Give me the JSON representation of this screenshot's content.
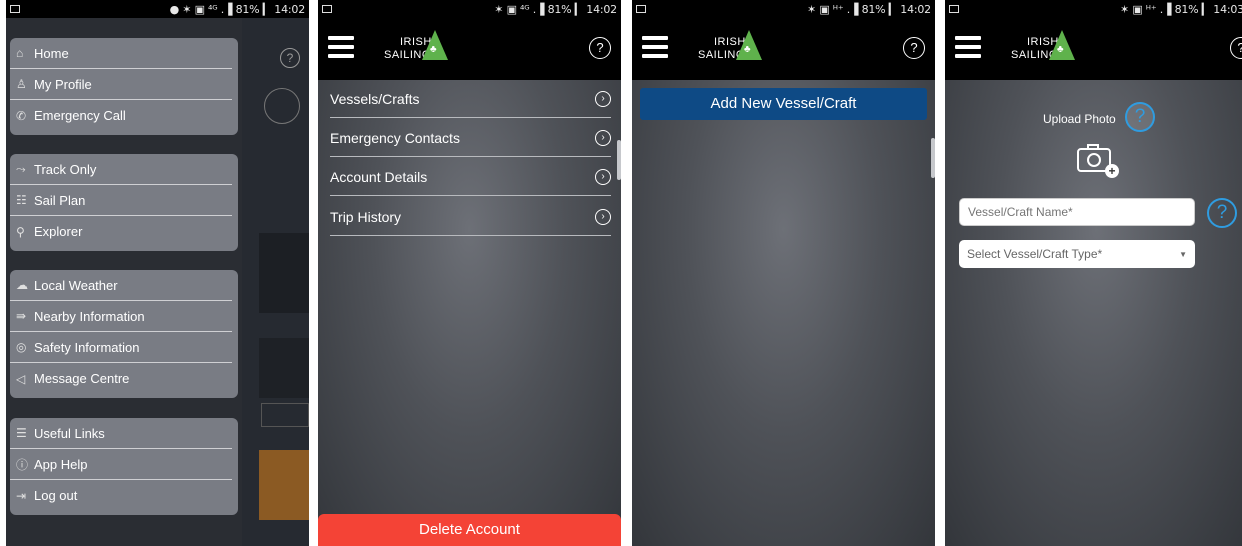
{
  "status_bar": {
    "p1": "● ✶ ▣ ⁴ᴳ .▐ 81% ▎ 14:02",
    "p2": "✶ ▣ ⁴ᴳ .▐ 81% ▎ 14:02",
    "p3": "✶ ▣ ᴴ⁺ .▐ 81% ▎ 14:02",
    "p4": "✶ ▣ ᴴ⁺ .▐ 81% ▎ 14:03"
  },
  "logo": {
    "line1": "IRISH",
    "line2": "SAILING"
  },
  "help_glyph": "?",
  "drawer": {
    "group1": [
      {
        "label": "Home",
        "icon": "home-icon"
      },
      {
        "label": "My Profile",
        "icon": "profile-icon"
      },
      {
        "label": "Emergency Call",
        "icon": "phone-icon"
      }
    ],
    "group2": [
      {
        "label": "Track Only",
        "icon": "track-icon"
      },
      {
        "label": "Sail Plan",
        "icon": "sail-plan-icon"
      },
      {
        "label": "Explorer",
        "icon": "explorer-icon"
      }
    ],
    "group3": [
      {
        "label": "Local Weather",
        "icon": "weather-icon"
      },
      {
        "label": "Nearby Information",
        "icon": "nearby-icon"
      },
      {
        "label": "Safety Information",
        "icon": "lifebuoy-icon"
      },
      {
        "label": "Message Centre",
        "icon": "megaphone-icon"
      }
    ],
    "group4": [
      {
        "label": "Useful Links",
        "icon": "links-icon"
      },
      {
        "label": "App Help",
        "icon": "info-icon"
      },
      {
        "label": "Log out",
        "icon": "logout-icon"
      }
    ]
  },
  "account_menu": {
    "items": [
      "Vessels/Crafts",
      "Emergency Contacts",
      "Account Details",
      "Trip History"
    ],
    "delete_label": "Delete Account"
  },
  "vessels": {
    "add_label": "Add New Vessel/Craft"
  },
  "new_vessel": {
    "upload_label": "Upload Photo",
    "name_placeholder": "Vessel/Craft Name*",
    "type_placeholder": "Select Vessel/Craft Type*"
  }
}
